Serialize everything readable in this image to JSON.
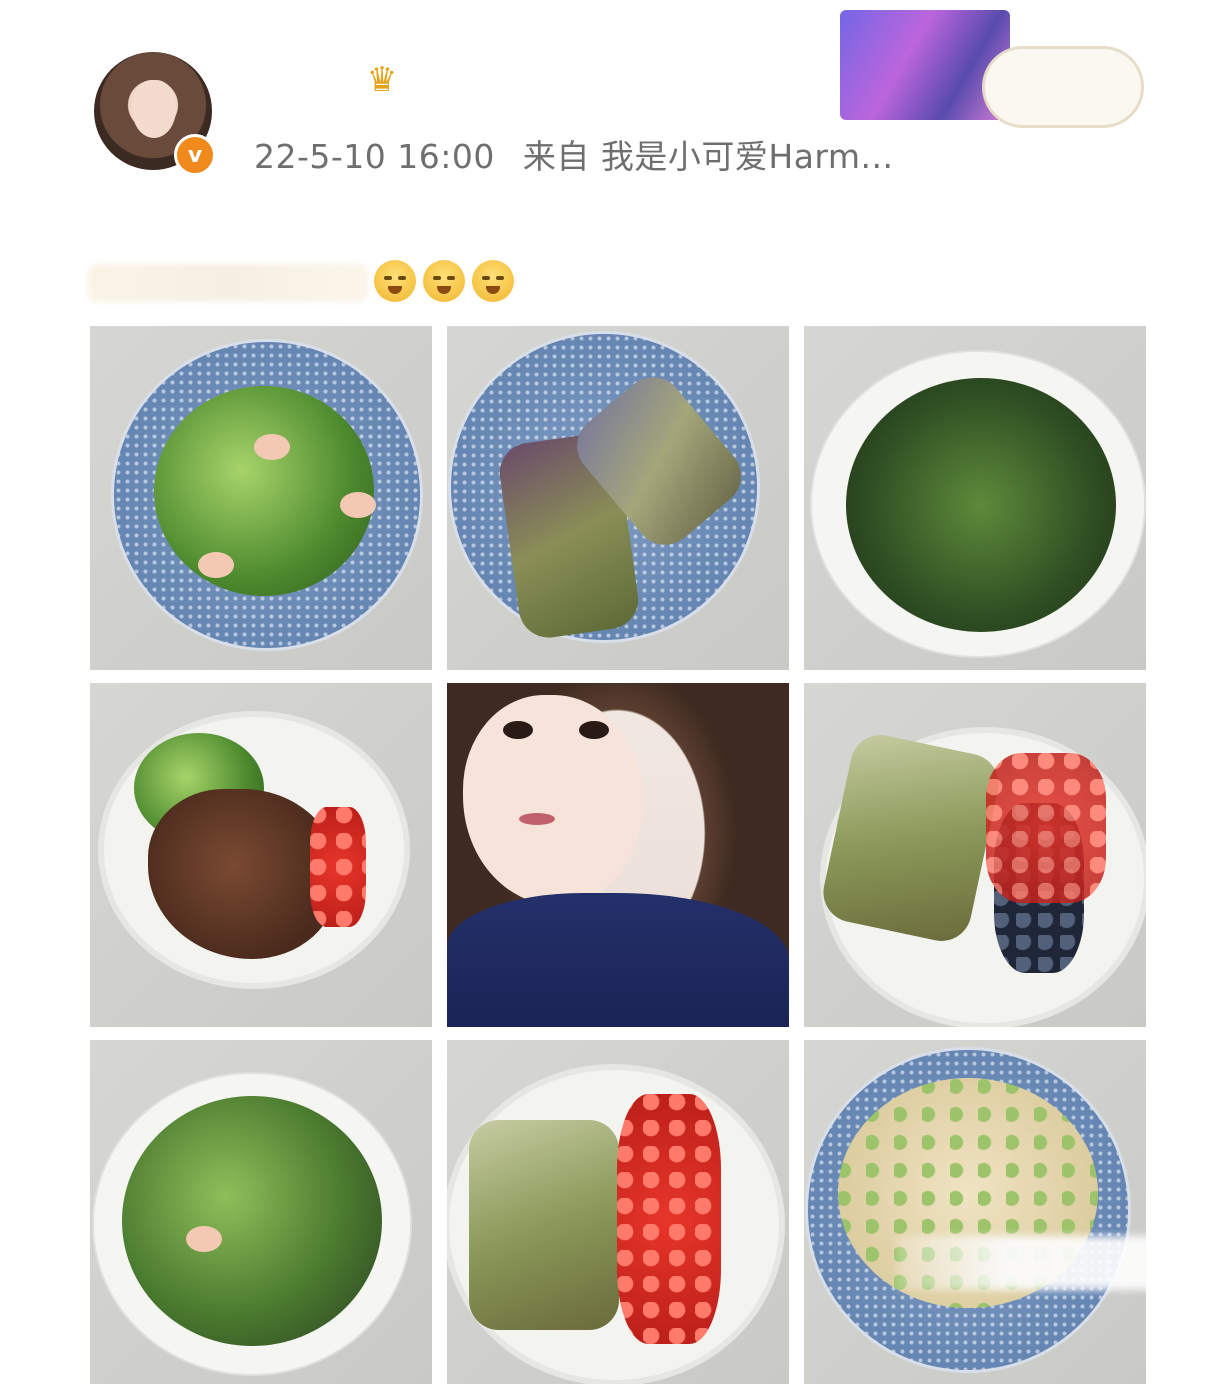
{
  "post": {
    "timestamp": "22-5-10 16:00",
    "source_prefix": "来自",
    "source_device": "我是小可爱Harm...",
    "author_badge": "v"
  },
  "photos": [
    {
      "name": "photo-shrimp-broccoli"
    },
    {
      "name": "photo-eggplant-rolls"
    },
    {
      "name": "photo-seaweed-soup"
    },
    {
      "name": "photo-beef-broccoli"
    },
    {
      "name": "photo-selfie"
    },
    {
      "name": "photo-spring-rolls-berries"
    },
    {
      "name": "photo-shrimp-soup"
    },
    {
      "name": "photo-spring-rolls-tomatoes"
    },
    {
      "name": "photo-chicken-cucumber"
    }
  ],
  "icons": {
    "crown": "crown-icon",
    "verified": "verified-icon",
    "emoji": "smiling-face-icon"
  },
  "colors": {
    "verified_badge": "#f08a1c",
    "meta_text": "#6f6f6f"
  }
}
